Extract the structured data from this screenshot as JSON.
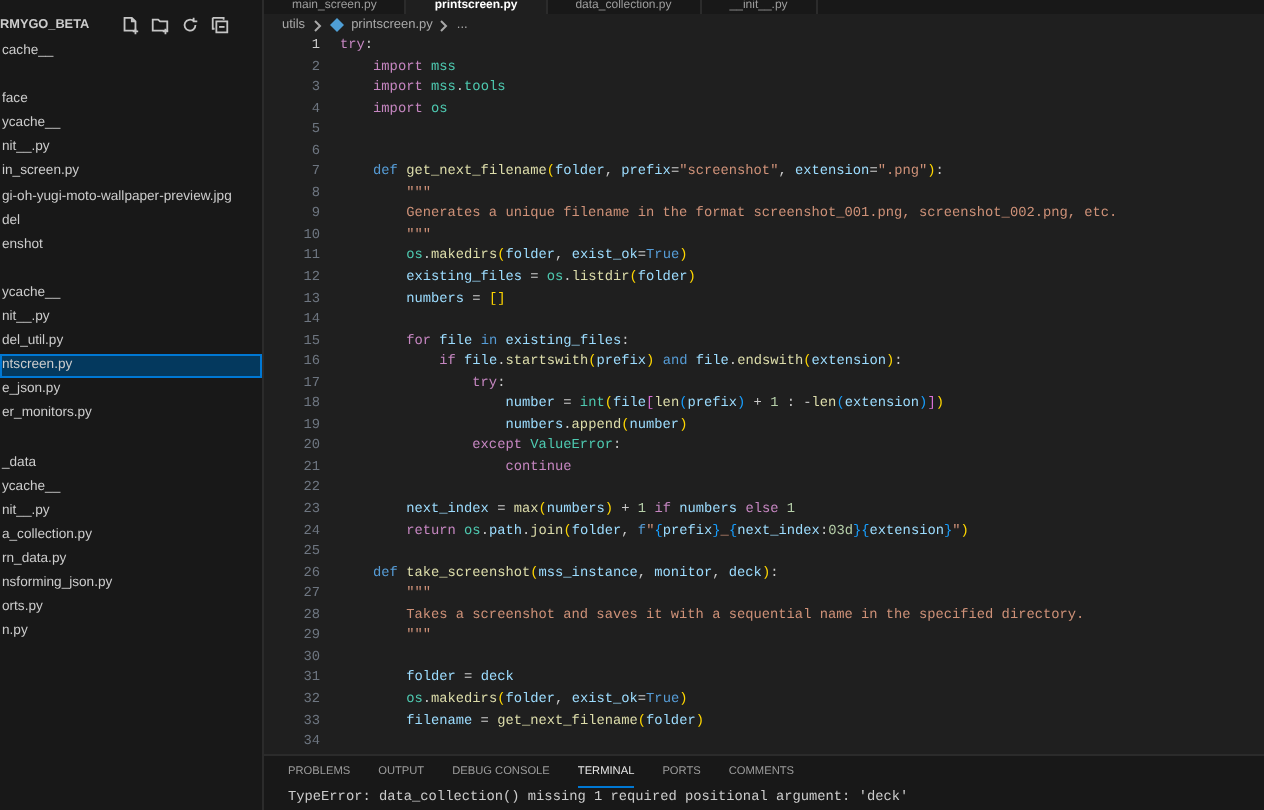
{
  "editor_tabs": [
    {
      "label": "main_screen.py",
      "selected": false
    },
    {
      "label": "printscreen.py",
      "selected": true
    },
    {
      "label": "data_collection.py",
      "selected": false
    },
    {
      "label": "__init__.py",
      "selected": false
    }
  ],
  "explorer": {
    "title": "RMYGO_BETA",
    "items": [
      {
        "kind": "file",
        "label": "cache__",
        "selected": false
      },
      {
        "kind": "spacer"
      },
      {
        "kind": "file",
        "label": "face",
        "selected": false
      },
      {
        "kind": "file",
        "label": "ycache__",
        "selected": false
      },
      {
        "kind": "file",
        "label": "nit__.py",
        "selected": false
      },
      {
        "kind": "file",
        "label": "in_screen.py",
        "selected": false
      },
      {
        "kind": "file",
        "label": "gi-oh-yugi-moto-wallpaper-preview.jpg",
        "selected": false
      },
      {
        "kind": "file",
        "label": "del",
        "selected": false
      },
      {
        "kind": "file",
        "label": "enshot",
        "selected": false
      },
      {
        "kind": "spacer"
      },
      {
        "kind": "file",
        "label": "ycache__",
        "selected": false
      },
      {
        "kind": "file",
        "label": "nit__.py",
        "selected": false
      },
      {
        "kind": "file",
        "label": "del_util.py",
        "selected": false
      },
      {
        "kind": "file",
        "label": "ntscreen.py",
        "selected": true
      },
      {
        "kind": "file",
        "label": "e_json.py",
        "selected": false
      },
      {
        "kind": "file",
        "label": "er_monitors.py",
        "selected": false
      },
      {
        "kind": "spacer"
      },
      {
        "kind": "file",
        "label": "_data",
        "selected": false
      },
      {
        "kind": "file",
        "label": "ycache__",
        "selected": false
      },
      {
        "kind": "file",
        "label": "nit__.py",
        "selected": false
      },
      {
        "kind": "file",
        "label": "a_collection.py",
        "selected": false
      },
      {
        "kind": "file",
        "label": "rn_data.py",
        "selected": false
      },
      {
        "kind": "file",
        "label": "nsforming_json.py",
        "selected": false
      },
      {
        "kind": "file",
        "label": "orts.py",
        "selected": false
      },
      {
        "kind": "file",
        "label": "n.py",
        "selected": false
      }
    ]
  },
  "breadcrumb": [
    "utils",
    "printscreen.py",
    "..."
  ],
  "code": [
    {
      "n": "1",
      "active": true,
      "tokens": [
        {
          "kind": "kw",
          "text": "try"
        },
        {
          "kind": "p",
          "text": ":"
        }
      ]
    },
    {
      "n": "2",
      "active": false,
      "tokens": [
        {
          "kind": "kw",
          "text": "    import"
        },
        {
          "kind": "mod",
          "text": " mss"
        }
      ]
    },
    {
      "n": "3",
      "active": false,
      "tokens": [
        {
          "kind": "kw",
          "text": "    import"
        },
        {
          "kind": "mod",
          "text": " mss"
        },
        {
          "kind": "p",
          "text": "."
        },
        {
          "kind": "mod",
          "text": "tools"
        }
      ]
    },
    {
      "n": "4",
      "active": false,
      "tokens": [
        {
          "kind": "kw",
          "text": "    import"
        },
        {
          "kind": "mod",
          "text": " os"
        }
      ]
    },
    {
      "n": "5",
      "active": false
    },
    {
      "n": "6",
      "active": false
    },
    {
      "n": "7",
      "active": false,
      "tokens": [
        {
          "kind": "def",
          "text": "    def"
        },
        {
          "kind": "fn",
          "text": " get_next_filename"
        },
        {
          "kind": "b1",
          "text": "("
        },
        {
          "kind": "var",
          "text": "folder"
        },
        {
          "kind": "p",
          "text": ","
        },
        {
          "kind": "var",
          "text": " prefix"
        },
        {
          "kind": "p",
          "text": "="
        },
        {
          "kind": "str",
          "text": "\"screenshot\""
        },
        {
          "kind": "p",
          "text": ","
        },
        {
          "kind": "var",
          "text": " extension"
        },
        {
          "kind": "p",
          "text": "="
        },
        {
          "kind": "str",
          "text": "\".png\""
        },
        {
          "kind": "b1",
          "text": ")"
        },
        {
          "kind": "p",
          "text": ":"
        }
      ]
    },
    {
      "n": "8",
      "active": false,
      "tokens": [
        {
          "kind": "str",
          "text": "        \"\"\""
        }
      ]
    },
    {
      "n": "9",
      "active": false,
      "tokens": [
        {
          "kind": "str",
          "text": "        Generates a unique filename in the format screenshot_001.png, screenshot_002.png, etc."
        }
      ]
    },
    {
      "n": "10",
      "active": false,
      "tokens": [
        {
          "kind": "str",
          "text": "        \"\"\""
        }
      ]
    },
    {
      "n": "11",
      "active": false,
      "tokens": [
        {
          "kind": "mod",
          "text": "        os"
        },
        {
          "kind": "p",
          "text": "."
        },
        {
          "kind": "fn",
          "text": "makedirs"
        },
        {
          "kind": "b1",
          "text": "("
        },
        {
          "kind": "var",
          "text": "folder"
        },
        {
          "kind": "p",
          "text": ","
        },
        {
          "kind": "var",
          "text": " exist_ok"
        },
        {
          "kind": "p",
          "text": "="
        },
        {
          "kind": "def",
          "text": "True"
        },
        {
          "kind": "b1",
          "text": ")"
        }
      ]
    },
    {
      "n": "12",
      "active": false,
      "tokens": [
        {
          "kind": "var",
          "text": "        existing_files"
        },
        {
          "kind": "p",
          "text": " ="
        },
        {
          "kind": "mod",
          "text": " os"
        },
        {
          "kind": "p",
          "text": "."
        },
        {
          "kind": "fn",
          "text": "listdir"
        },
        {
          "kind": "b1",
          "text": "("
        },
        {
          "kind": "var",
          "text": "folder"
        },
        {
          "kind": "b1",
          "text": ")"
        }
      ]
    },
    {
      "n": "13",
      "active": false,
      "tokens": [
        {
          "kind": "var",
          "text": "        numbers"
        },
        {
          "kind": "p",
          "text": " ="
        },
        {
          "kind": "b1",
          "text": " []"
        }
      ]
    },
    {
      "n": "14",
      "active": false
    },
    {
      "n": "15",
      "active": false,
      "tokens": [
        {
          "kind": "kw",
          "text": "        for"
        },
        {
          "kind": "var",
          "text": " file"
        },
        {
          "kind": "def",
          "text": " in"
        },
        {
          "kind": "var",
          "text": " existing_files"
        },
        {
          "kind": "p",
          "text": ":"
        }
      ]
    },
    {
      "n": "16",
      "active": false,
      "tokens": [
        {
          "kind": "kw",
          "text": "            if"
        },
        {
          "kind": "var",
          "text": " file"
        },
        {
          "kind": "p",
          "text": "."
        },
        {
          "kind": "fn",
          "text": "startswith"
        },
        {
          "kind": "b1",
          "text": "("
        },
        {
          "kind": "var",
          "text": "prefix"
        },
        {
          "kind": "b1",
          "text": ")"
        },
        {
          "kind": "def",
          "text": " and"
        },
        {
          "kind": "var",
          "text": " file"
        },
        {
          "kind": "p",
          "text": "."
        },
        {
          "kind": "fn",
          "text": "endswith"
        },
        {
          "kind": "b1",
          "text": "("
        },
        {
          "kind": "var",
          "text": "extension"
        },
        {
          "kind": "b1",
          "text": ")"
        },
        {
          "kind": "p",
          "text": ":"
        }
      ]
    },
    {
      "n": "17",
      "active": false,
      "tokens": [
        {
          "kind": "kw",
          "text": "                try"
        },
        {
          "kind": "p",
          "text": ":"
        }
      ]
    },
    {
      "n": "18",
      "active": false,
      "tokens": [
        {
          "kind": "var",
          "text": "                    number"
        },
        {
          "kind": "p",
          "text": " ="
        },
        {
          "kind": "cls",
          "text": " int"
        },
        {
          "kind": "b1",
          "text": "("
        },
        {
          "kind": "var",
          "text": "file"
        },
        {
          "kind": "b2",
          "text": "["
        },
        {
          "kind": "fn",
          "text": "len"
        },
        {
          "kind": "b3",
          "text": "("
        },
        {
          "kind": "var",
          "text": "prefix"
        },
        {
          "kind": "b3",
          "text": ")"
        },
        {
          "kind": "p",
          "text": " +"
        },
        {
          "kind": "num",
          "text": " 1"
        },
        {
          "kind": "p",
          "text": " : -"
        },
        {
          "kind": "fn",
          "text": "len"
        },
        {
          "kind": "b3",
          "text": "("
        },
        {
          "kind": "var",
          "text": "extension"
        },
        {
          "kind": "b3",
          "text": ")"
        },
        {
          "kind": "b2",
          "text": "]"
        },
        {
          "kind": "b1",
          "text": ")"
        }
      ]
    },
    {
      "n": "19",
      "active": false,
      "tokens": [
        {
          "kind": "var",
          "text": "                    numbers"
        },
        {
          "kind": "p",
          "text": "."
        },
        {
          "kind": "fn",
          "text": "append"
        },
        {
          "kind": "b1",
          "text": "("
        },
        {
          "kind": "var",
          "text": "number"
        },
        {
          "kind": "b1",
          "text": ")"
        }
      ]
    },
    {
      "n": "20",
      "active": false,
      "tokens": [
        {
          "kind": "kw",
          "text": "                except"
        },
        {
          "kind": "cls",
          "text": " ValueError"
        },
        {
          "kind": "p",
          "text": ":"
        }
      ]
    },
    {
      "n": "21",
      "active": false,
      "tokens": [
        {
          "kind": "kw",
          "text": "                    continue"
        }
      ]
    },
    {
      "n": "22",
      "active": false
    },
    {
      "n": "23",
      "active": false,
      "tokens": [
        {
          "kind": "var",
          "text": "        next_index"
        },
        {
          "kind": "p",
          "text": " ="
        },
        {
          "kind": "fn",
          "text": " max"
        },
        {
          "kind": "b1",
          "text": "("
        },
        {
          "kind": "var",
          "text": "numbers"
        },
        {
          "kind": "b1",
          "text": ")"
        },
        {
          "kind": "p",
          "text": " +"
        },
        {
          "kind": "num",
          "text": " 1"
        },
        {
          "kind": "kw",
          "text": " if"
        },
        {
          "kind": "var",
          "text": " numbers"
        },
        {
          "kind": "kw",
          "text": " else"
        },
        {
          "kind": "num",
          "text": " 1"
        }
      ]
    },
    {
      "n": "24",
      "active": false,
      "tokens": [
        {
          "kind": "kw",
          "text": "        return"
        },
        {
          "kind": "mod",
          "text": " os"
        },
        {
          "kind": "p",
          "text": "."
        },
        {
          "kind": "var",
          "text": "path"
        },
        {
          "kind": "p",
          "text": "."
        },
        {
          "kind": "fn",
          "text": "join"
        },
        {
          "kind": "b1",
          "text": "("
        },
        {
          "kind": "var",
          "text": "folder"
        },
        {
          "kind": "p",
          "text": ","
        },
        {
          "kind": "def",
          "text": " f"
        },
        {
          "kind": "str",
          "text": "\""
        },
        {
          "kind": "b3",
          "text": "{"
        },
        {
          "kind": "var",
          "text": "prefix"
        },
        {
          "kind": "b3",
          "text": "}"
        },
        {
          "kind": "str",
          "text": "_"
        },
        {
          "kind": "b3",
          "text": "{"
        },
        {
          "kind": "var",
          "text": "next_index"
        },
        {
          "kind": "p",
          "text": ":"
        },
        {
          "kind": "num",
          "text": "03d"
        },
        {
          "kind": "b3",
          "text": "}{"
        },
        {
          "kind": "var",
          "text": "extension"
        },
        {
          "kind": "b3",
          "text": "}"
        },
        {
          "kind": "str",
          "text": "\""
        },
        {
          "kind": "b1",
          "text": ")"
        }
      ]
    },
    {
      "n": "25",
      "active": false
    },
    {
      "n": "26",
      "active": false,
      "tokens": [
        {
          "kind": "def",
          "text": "    def"
        },
        {
          "kind": "fn",
          "text": " take_screenshot"
        },
        {
          "kind": "b1",
          "text": "("
        },
        {
          "kind": "var",
          "text": "mss_instance"
        },
        {
          "kind": "p",
          "text": ","
        },
        {
          "kind": "var",
          "text": " monitor"
        },
        {
          "kind": "p",
          "text": ","
        },
        {
          "kind": "var",
          "text": " deck"
        },
        {
          "kind": "b1",
          "text": ")"
        },
        {
          "kind": "p",
          "text": ":"
        }
      ]
    },
    {
      "n": "27",
      "active": false,
      "tokens": [
        {
          "kind": "str",
          "text": "        \"\"\""
        }
      ]
    },
    {
      "n": "28",
      "active": false,
      "tokens": [
        {
          "kind": "str",
          "text": "        Takes a screenshot and saves it with a sequential name in the specified directory."
        }
      ]
    },
    {
      "n": "29",
      "active": false,
      "tokens": [
        {
          "kind": "str",
          "text": "        \"\"\""
        }
      ]
    },
    {
      "n": "30",
      "active": false
    },
    {
      "n": "31",
      "active": false,
      "tokens": [
        {
          "kind": "var",
          "text": "        folder"
        },
        {
          "kind": "p",
          "text": " ="
        },
        {
          "kind": "var",
          "text": " deck"
        }
      ]
    },
    {
      "n": "32",
      "active": false,
      "tokens": [
        {
          "kind": "mod",
          "text": "        os"
        },
        {
          "kind": "p",
          "text": "."
        },
        {
          "kind": "fn",
          "text": "makedirs"
        },
        {
          "kind": "b1",
          "text": "("
        },
        {
          "kind": "var",
          "text": "folder"
        },
        {
          "kind": "p",
          "text": ","
        },
        {
          "kind": "var",
          "text": " exist_ok"
        },
        {
          "kind": "p",
          "text": "="
        },
        {
          "kind": "def",
          "text": "True"
        },
        {
          "kind": "b1",
          "text": ")"
        }
      ]
    },
    {
      "n": "33",
      "active": false,
      "tokens": [
        {
          "kind": "var",
          "text": "        filename"
        },
        {
          "kind": "p",
          "text": " ="
        },
        {
          "kind": "fn",
          "text": " get_next_filename"
        },
        {
          "kind": "b1",
          "text": "("
        },
        {
          "kind": "var",
          "text": "folder"
        },
        {
          "kind": "b1",
          "text": ")"
        }
      ]
    },
    {
      "n": "34",
      "active": false
    }
  ],
  "panel": {
    "tabs": [
      {
        "label": "PROBLEMS",
        "selected": false
      },
      {
        "label": "OUTPUT",
        "selected": false
      },
      {
        "label": "DEBUG CONSOLE",
        "selected": false
      },
      {
        "label": "TERMINAL",
        "selected": true
      },
      {
        "label": "PORTS",
        "selected": false
      },
      {
        "label": "COMMENTS",
        "selected": false
      }
    ],
    "terminal_lines": [
      "TypeError: data_collection() missing 1 required positional argument: 'deck'"
    ]
  }
}
